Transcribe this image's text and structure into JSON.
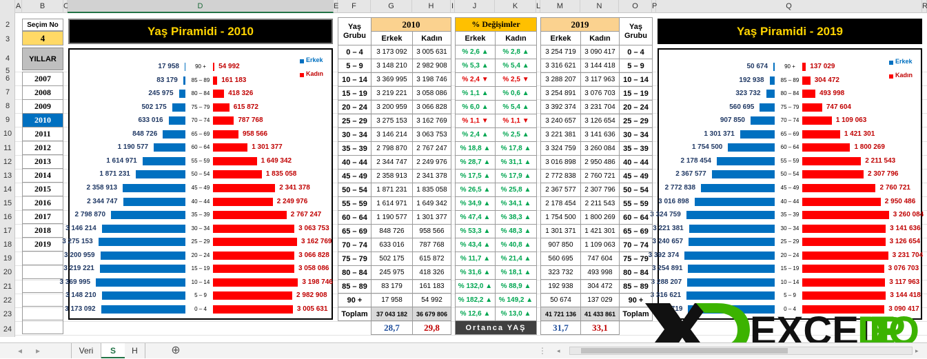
{
  "columns": [
    "A",
    "B",
    "C",
    "D",
    "E",
    "F",
    "G",
    "H",
    "I",
    "J",
    "K",
    "L",
    "M",
    "N",
    "O",
    "P",
    "Q",
    "R"
  ],
  "rows": [
    "2",
    "3",
    "4",
    "5",
    "6",
    "7",
    "8",
    "9",
    "10",
    "11",
    "12",
    "13",
    "14",
    "15",
    "16",
    "17",
    "18",
    "19",
    "20",
    "21",
    "22",
    "23",
    "24"
  ],
  "selector": {
    "label": "Seçim No",
    "value": "4",
    "header": "YILLAR"
  },
  "years": [
    "2007",
    "2008",
    "2009",
    "2010",
    "2011",
    "2012",
    "2013",
    "2014",
    "2015",
    "2016",
    "2017",
    "2018",
    "2019"
  ],
  "selected_year": "2010",
  "chart_2010": {
    "title": "Yaş Piramidi - 2010",
    "legend_m": "Erkek",
    "legend_f": "Kadın"
  },
  "chart_2019": {
    "title": "Yaş Piramidi - 2019",
    "legend_m": "Erkek",
    "legend_f": "Kadın"
  },
  "chart_data": [
    {
      "type": "bar",
      "title": "Yaş Piramidi - 2010",
      "orientation": "horizontal-pyramid",
      "categories": [
        "90 +",
        "85 – 89",
        "80 – 84",
        "75 – 79",
        "70 – 74",
        "65 – 69",
        "60 – 64",
        "55 – 59",
        "50 – 54",
        "45 – 49",
        "40 – 44",
        "35 – 39",
        "30 – 34",
        "25 – 29",
        "20 – 24",
        "15 – 19",
        "10 – 14",
        "5 – 9",
        "0 – 4"
      ],
      "series": [
        {
          "name": "Erkek",
          "values": [
            17958,
            83179,
            245975,
            502175,
            633016,
            848726,
            1190577,
            1614971,
            1871231,
            2358913,
            2344747,
            2798870,
            3146214,
            3275153,
            3200959,
            3219221,
            3369995,
            3148210,
            3173092
          ],
          "labels": [
            "17 958",
            "83 179",
            "245 975",
            "502 175",
            "633 016",
            "848 726",
            "1 190 577",
            "1 614 971",
            "1 871 231",
            "2 358 913",
            "2 344 747",
            "2 798 870",
            "3 146 214",
            "3 275 153",
            "3 200 959",
            "3 219 221",
            "3 369 995",
            "3 148 210",
            "3 173 092"
          ]
        },
        {
          "name": "Kadın",
          "values": [
            54992,
            161183,
            418326,
            615872,
            787768,
            958566,
            1301377,
            1649342,
            1835058,
            2341378,
            2249976,
            2767247,
            3063753,
            3162769,
            3066828,
            3058086,
            3198746,
            2982908,
            3005631
          ],
          "labels": [
            "54 992",
            "161 183",
            "418 326",
            "615 872",
            "787 768",
            "958 566",
            "1 301 377",
            "1 649 342",
            "1 835 058",
            "2 341 378",
            "2 249 976",
            "2 767 247",
            "3 063 753",
            "3 162 769",
            "3 066 828",
            "3 058 086",
            "3 198 746",
            "2 982 908",
            "3 005 631"
          ]
        }
      ],
      "colors": {
        "m": "#0070c0",
        "f": "#ff0000"
      },
      "legend": "top-right"
    },
    {
      "type": "bar",
      "title": "Yaş Piramidi - 2019",
      "orientation": "horizontal-pyramid",
      "categories": [
        "90 +",
        "85 – 89",
        "80 – 84",
        "75 – 79",
        "70 – 74",
        "65 – 69",
        "60 – 64",
        "55 – 59",
        "50 – 54",
        "45 – 49",
        "40 – 44",
        "35 – 39",
        "30 – 34",
        "25 – 29",
        "20 – 24",
        "15 – 19",
        "10 – 14",
        "5 – 9",
        "0 – 4"
      ],
      "series": [
        {
          "name": "Erkek",
          "values": [
            50674,
            192938,
            323732,
            560695,
            907850,
            1301371,
            1754500,
            2178454,
            2367577,
            2772838,
            3016898,
            3324759,
            3221381,
            3240657,
            3392374,
            3254891,
            3288207,
            3316621,
            3254719
          ],
          "labels": [
            "50 674",
            "192 938",
            "323 732",
            "560 695",
            "907 850",
            "1 301 371",
            "1 754 500",
            "2 178 454",
            "2 367 577",
            "2 772 838",
            "3 016 898",
            "3 324 759",
            "3 221 381",
            "3 240 657",
            "3 392 374",
            "3 254 891",
            "3 288 207",
            "3 316 621",
            "254 719"
          ]
        },
        {
          "name": "Kadın",
          "values": [
            137029,
            304472,
            493998,
            747604,
            1109063,
            1421301,
            1800269,
            2211543,
            2307796,
            2760721,
            2950486,
            3260084,
            3141636,
            3126654,
            3231704,
            3076703,
            3117963,
            3144418,
            3090417
          ],
          "labels": [
            "137 029",
            "304 472",
            "493 998",
            "747 604",
            "1 109 063",
            "1 421 301",
            "1 800 269",
            "2 211 543",
            "2 307 796",
            "2 760 721",
            "2 950 486",
            "3 260 084",
            "3 141 636",
            "3 126 654",
            "3 231 704",
            "3 076 703",
            "3 117 963",
            "3 144 418",
            "3 090 417"
          ]
        }
      ],
      "colors": {
        "m": "#0070c0",
        "f": "#ff0000"
      },
      "legend": "top-right"
    }
  ],
  "table": {
    "age_header": "Yaş Grubu",
    "h2010": "2010",
    "h2019": "2019",
    "hchange": "% Değişimler",
    "erkek": "Erkek",
    "kadin": "Kadın",
    "rows": [
      {
        "age": "0 – 4",
        "m10": "3 173 092",
        "f10": "3 005 631",
        "cm": "% 2,6",
        "cmd": "up",
        "cf": "% 2,8",
        "cfd": "up",
        "m19": "3 254 719",
        "f19": "3 090 417"
      },
      {
        "age": "5 – 9",
        "m10": "3 148 210",
        "f10": "2 982 908",
        "cm": "% 5,3",
        "cmd": "up",
        "cf": "% 5,4",
        "cfd": "up",
        "m19": "3 316 621",
        "f19": "3 144 418"
      },
      {
        "age": "10 – 14",
        "m10": "3 369 995",
        "f10": "3 198 746",
        "cm": "% 2,4",
        "cmd": "down",
        "cf": "% 2,5",
        "cfd": "down",
        "m19": "3 288 207",
        "f19": "3 117 963"
      },
      {
        "age": "15 – 19",
        "m10": "3 219 221",
        "f10": "3 058 086",
        "cm": "% 1,1",
        "cmd": "up",
        "cf": "% 0,6",
        "cfd": "up",
        "m19": "3 254 891",
        "f19": "3 076 703"
      },
      {
        "age": "20 – 24",
        "m10": "3 200 959",
        "f10": "3 066 828",
        "cm": "% 6,0",
        "cmd": "up",
        "cf": "% 5,4",
        "cfd": "up",
        "m19": "3 392 374",
        "f19": "3 231 704"
      },
      {
        "age": "25 – 29",
        "m10": "3 275 153",
        "f10": "3 162 769",
        "cm": "% 1,1",
        "cmd": "down",
        "cf": "% 1,1",
        "cfd": "down",
        "m19": "3 240 657",
        "f19": "3 126 654"
      },
      {
        "age": "30 – 34",
        "m10": "3 146 214",
        "f10": "3 063 753",
        "cm": "% 2,4",
        "cmd": "up",
        "cf": "% 2,5",
        "cfd": "up",
        "m19": "3 221 381",
        "f19": "3 141 636"
      },
      {
        "age": "35 – 39",
        "m10": "2 798 870",
        "f10": "2 767 247",
        "cm": "% 18,8",
        "cmd": "up",
        "cf": "% 17,8",
        "cfd": "up",
        "m19": "3 324 759",
        "f19": "3 260 084"
      },
      {
        "age": "40 – 44",
        "m10": "2 344 747",
        "f10": "2 249 976",
        "cm": "% 28,7",
        "cmd": "up",
        "cf": "% 31,1",
        "cfd": "up",
        "m19": "3 016 898",
        "f19": "2 950 486"
      },
      {
        "age": "45 – 49",
        "m10": "2 358 913",
        "f10": "2 341 378",
        "cm": "% 17,5",
        "cmd": "up",
        "cf": "% 17,9",
        "cfd": "up",
        "m19": "2 772 838",
        "f19": "2 760 721"
      },
      {
        "age": "50 – 54",
        "m10": "1 871 231",
        "f10": "1 835 058",
        "cm": "% 26,5",
        "cmd": "up",
        "cf": "% 25,8",
        "cfd": "up",
        "m19": "2 367 577",
        "f19": "2 307 796"
      },
      {
        "age": "55 – 59",
        "m10": "1 614 971",
        "f10": "1 649 342",
        "cm": "% 34,9",
        "cmd": "up",
        "cf": "% 34,1",
        "cfd": "up",
        "m19": "2 178 454",
        "f19": "2 211 543"
      },
      {
        "age": "60 – 64",
        "m10": "1 190 577",
        "f10": "1 301 377",
        "cm": "% 47,4",
        "cmd": "up",
        "cf": "% 38,3",
        "cfd": "up",
        "m19": "1 754 500",
        "f19": "1 800 269"
      },
      {
        "age": "65 – 69",
        "m10": "848 726",
        "f10": "958 566",
        "cm": "% 53,3",
        "cmd": "up",
        "cf": "% 48,3",
        "cfd": "up",
        "m19": "1 301 371",
        "f19": "1 421 301"
      },
      {
        "age": "70 – 74",
        "m10": "633 016",
        "f10": "787 768",
        "cm": "% 43,4",
        "cmd": "up",
        "cf": "% 40,8",
        "cfd": "up",
        "m19": "907 850",
        "f19": "1 109 063"
      },
      {
        "age": "75 – 79",
        "m10": "502 175",
        "f10": "615 872",
        "cm": "% 11,7",
        "cmd": "up",
        "cf": "% 21,4",
        "cfd": "up",
        "m19": "560 695",
        "f19": "747 604"
      },
      {
        "age": "80 – 84",
        "m10": "245 975",
        "f10": "418 326",
        "cm": "% 31,6",
        "cmd": "up",
        "cf": "% 18,1",
        "cfd": "up",
        "m19": "323 732",
        "f19": "493 998"
      },
      {
        "age": "85 – 89",
        "m10": "83 179",
        "f10": "161 183",
        "cm": "% 132,0",
        "cmd": "up",
        "cf": "% 88,9",
        "cfd": "up",
        "m19": "192 938",
        "f19": "304 472"
      },
      {
        "age": "90 +",
        "m10": "17 958",
        "f10": "54 992",
        "cm": "% 182,2",
        "cmd": "up",
        "cf": "% 149,2",
        "cfd": "up",
        "m19": "50 674",
        "f19": "137 029"
      }
    ],
    "total": {
      "label": "Toplam",
      "m10": "37 043 182",
      "f10": "36 679 806",
      "cm": "% 12,6",
      "cf": "% 13,0",
      "m19": "41 721 136",
      "f19": "41 433 861"
    },
    "median": {
      "label": "Ortanca YAŞ",
      "m10": "28,7",
      "f10": "29,8",
      "m19": "31,7",
      "f19": "33,1"
    }
  },
  "watermark": "EXCELDEPO",
  "tabs": [
    "Veri",
    "S",
    "H"
  ],
  "active_tab": "S"
}
